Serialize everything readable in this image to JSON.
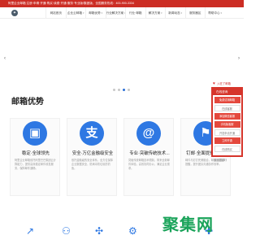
{
  "topbar": {
    "text": "阿里企业邮箱 注册·申请·开通·购买·续费·开通·服务·专业版/集团版，全国服务热线：400-900-3334"
  },
  "header": {
    "logo_glyph": "✦",
    "nav": [
      {
        "label": "网站首页",
        "dropdown": false
      },
      {
        "label": "企业云邮箱",
        "dropdown": true
      },
      {
        "label": "邮箱优势",
        "dropdown": true
      },
      {
        "label": "行业解决方案",
        "dropdown": true
      },
      {
        "label": "行业·邮箱",
        "dropdown": false
      },
      {
        "label": "解决方案",
        "dropdown": true
      },
      {
        "label": "新闻动态",
        "dropdown": true
      },
      {
        "label": "服务器区",
        "dropdown": false
      },
      {
        "label": "帮助中心",
        "dropdown": true
      }
    ]
  },
  "banner": {
    "prev": "‹",
    "next": "›",
    "dots": 4,
    "active_dot": 2
  },
  "float_panel": {
    "head": "入驻了邮箱",
    "title": "在线咨询",
    "items": [
      {
        "label": "免费试用邮箱",
        "style": "red"
      },
      {
        "label": "在线客服",
        "style": "plain"
      },
      {
        "label": "添加微信客服",
        "style": "red"
      },
      {
        "label": "手机版客服",
        "style": "red"
      },
      {
        "label": "开发申请开通",
        "style": "plain"
      },
      {
        "label": "立即开通",
        "style": "red"
      },
      {
        "label": "在线购买",
        "style": "plain"
      }
    ],
    "foot": "返回顶部",
    "foot_icon": "↑"
  },
  "section": {
    "title": "邮箱优势"
  },
  "features": [
    {
      "icon": "passport-icon",
      "glyph": "▣",
      "title": "稳定·全球领先",
      "desc": "阿里企业邮箱依托阿里巴巴集团云计算能力，提供高效稳定邮件收发服务，保障邮件通畅。"
    },
    {
      "icon": "alipay-icon",
      "glyph": "支",
      "title": "安全·万亿金融级安全",
      "desc": "依托金融级的安全体系，全方位保障企业数据安全，防病毒防垃圾防钓鱼。"
    },
    {
      "icon": "at-icon",
      "glyph": "@",
      "title": "专业·突破传统技术...",
      "desc": "突破传统邮箱技术限制，带来全新邮件体验，高效协同办公，满足企业需求。"
    },
    {
      "icon": "dingtalk-icon",
      "glyph": "⚑",
      "title": "钉邮·全面提升沟通...",
      "desc": "邮件与钉钉完美融合，邮件消息实时提醒，提升团队沟通协作效率。"
    }
  ],
  "bottom": {
    "icons": [
      "↗",
      "⚇",
      "✣",
      "⚙",
      "✚"
    ],
    "watermark": "聚集网"
  }
}
